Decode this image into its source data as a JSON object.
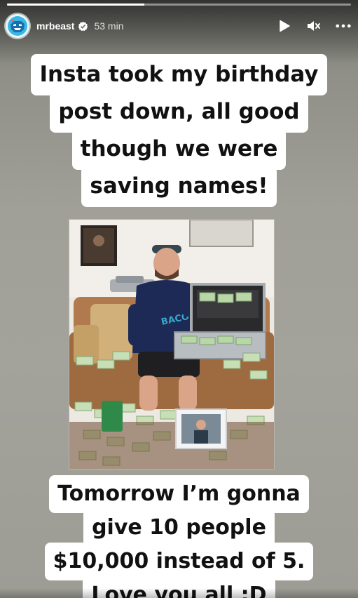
{
  "progress": {
    "fraction": 0.4
  },
  "header": {
    "avatar_icon": "beast-mascot-icon",
    "username": "mrbeast",
    "verified_icon": "verified-badge-icon",
    "time_ago": "53 min",
    "play_icon": "play-icon",
    "mute_icon": "muted-speaker-icon",
    "more_icon": "more-options-icon"
  },
  "caption_top": {
    "lines": [
      "Insta took my birthday",
      "post down, all good",
      "though we were",
      "saving names!"
    ]
  },
  "photo": {
    "icon": "photo-money-briefcase"
  },
  "caption_bottom": {
    "lines": [
      "Tomorrow I’m gonna",
      "give 10 people",
      "$10,000 instead of 5.",
      "Love you all :D"
    ]
  },
  "colors": {
    "accent": "#ffffff",
    "background": "#a09f98",
    "caption_bg": "#ffffff",
    "caption_text": "#111111"
  }
}
